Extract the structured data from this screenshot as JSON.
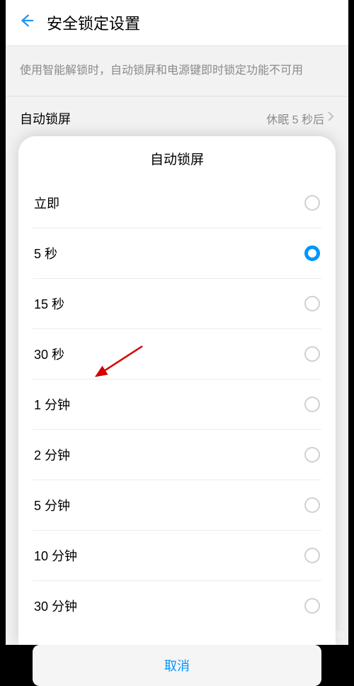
{
  "header": {
    "title": "安全锁定设置"
  },
  "info": {
    "text": "使用智能解锁时，自动锁屏和电源键即时锁定功能不可用"
  },
  "setting": {
    "label": "自动锁屏",
    "value": "休眠 5 秒后"
  },
  "modal": {
    "title": "自动锁屏",
    "options": [
      {
        "label": "立即",
        "selected": false
      },
      {
        "label": "5 秒",
        "selected": true
      },
      {
        "label": "15 秒",
        "selected": false
      },
      {
        "label": "30 秒",
        "selected": false
      },
      {
        "label": "1 分钟",
        "selected": false
      },
      {
        "label": "2 分钟",
        "selected": false
      },
      {
        "label": "5 分钟",
        "selected": false
      },
      {
        "label": "10 分钟",
        "selected": false
      },
      {
        "label": "30 分钟",
        "selected": false
      }
    ],
    "cancel_label": "取消"
  },
  "watermark": "Bai经验"
}
